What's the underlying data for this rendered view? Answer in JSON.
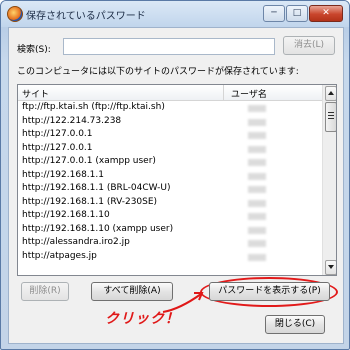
{
  "window": {
    "title": "保存されているパスワード",
    "controls": {
      "minimize": "─",
      "maximize": "□",
      "close": "✕"
    }
  },
  "search": {
    "label": "検索(S):",
    "value": "",
    "clear_button": "消去(L)"
  },
  "intro_text": "このコンピュータには以下のサイトのパスワードが保存されています:",
  "list": {
    "columns": [
      "サイト",
      "ユーザ名"
    ],
    "rows": [
      "ftp://ftp.ktai.sh (ftp://ftp.ktai.sh)",
      "http://122.214.73.238",
      "http://127.0.0.1",
      "http://127.0.0.1",
      "http://127.0.0.1 (xampp user)",
      "http://192.168.1.1",
      "http://192.168.1.1 (BRL-04CW-U)",
      "http://192.168.1.1 (RV-230SE)",
      "http://192.168.1.10",
      "http://192.168.1.10 (xampp user)",
      "http://alessandra.iro2.jp",
      "http://atpages.jp"
    ]
  },
  "buttons": {
    "delete": "削除(R)",
    "delete_all": "すべて削除(A)",
    "show_passwords": "パスワードを表示する(P)",
    "close": "閉じる(C)"
  },
  "annotation": "クリック！",
  "colors": {
    "annotation": "#e01818",
    "titlebar": "#c1d5ec",
    "close_button": "#c9452c"
  }
}
